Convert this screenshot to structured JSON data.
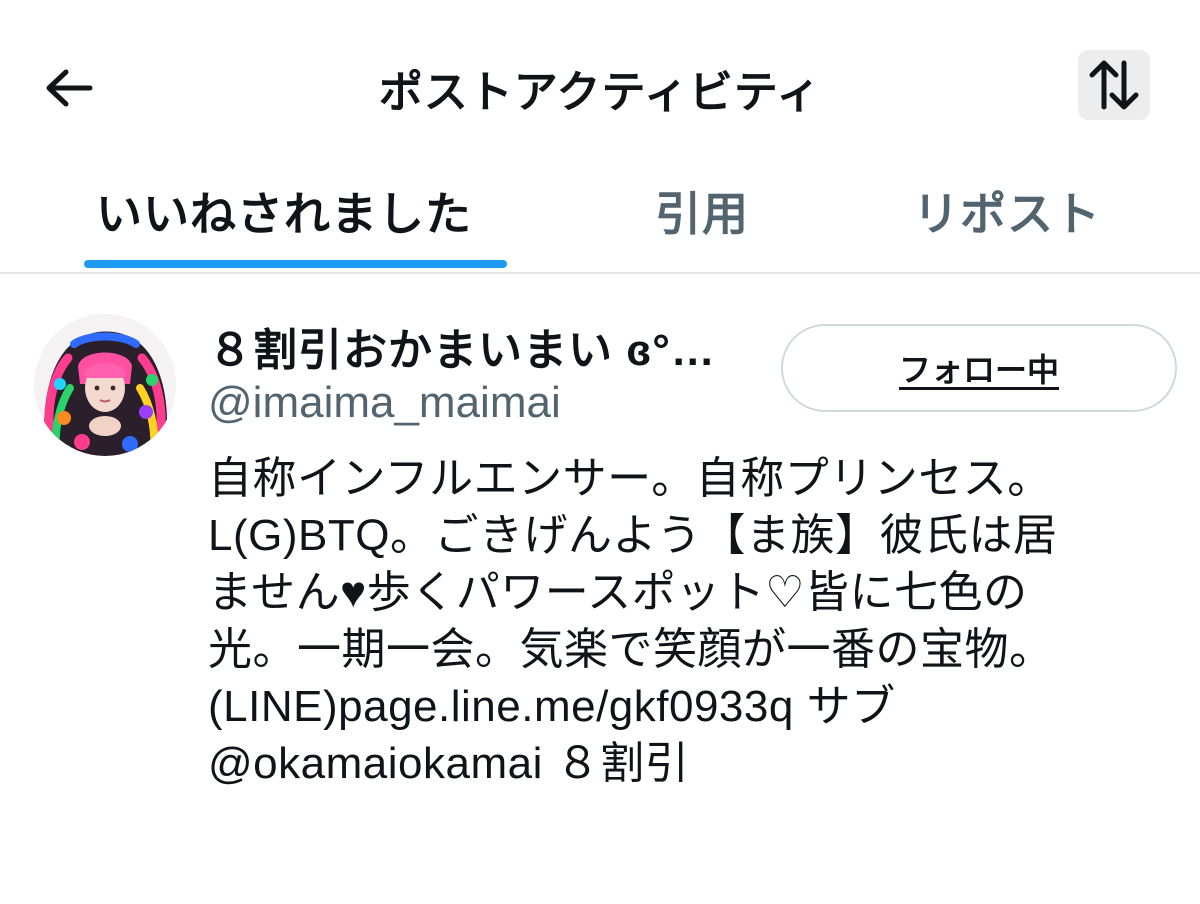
{
  "header": {
    "title": "ポストアクティビティ",
    "back_icon": "back-arrow-icon",
    "sort_icon": "sort-arrows-icon"
  },
  "tabs": [
    {
      "label": "いいねされました",
      "active": true
    },
    {
      "label": "引用",
      "active": false
    },
    {
      "label": "リポスト",
      "active": false
    }
  ],
  "colors": {
    "accent": "#1d9bf0",
    "text_primary": "#0f1419",
    "text_secondary": "#536471",
    "divider": "#e6e6e6"
  },
  "user": {
    "display_name": "８割引おかまいまい ɞ°…",
    "handle": "@imaima_maimai",
    "follow_label": "フォロー中",
    "bio_lines": [
      "自称インフルエンサー。自称プリンセス。",
      "L(G)BTQ。ごきげんよう【ま族】彼氏は居",
      "ません♥歩くパワースポット♡皆に七色の",
      "光。一期一会。気楽で笑顔が一番の宝物。",
      "(LINE)page.line.me/gkf0933q サブ",
      "@okamaiokamai ８割引"
    ]
  }
}
